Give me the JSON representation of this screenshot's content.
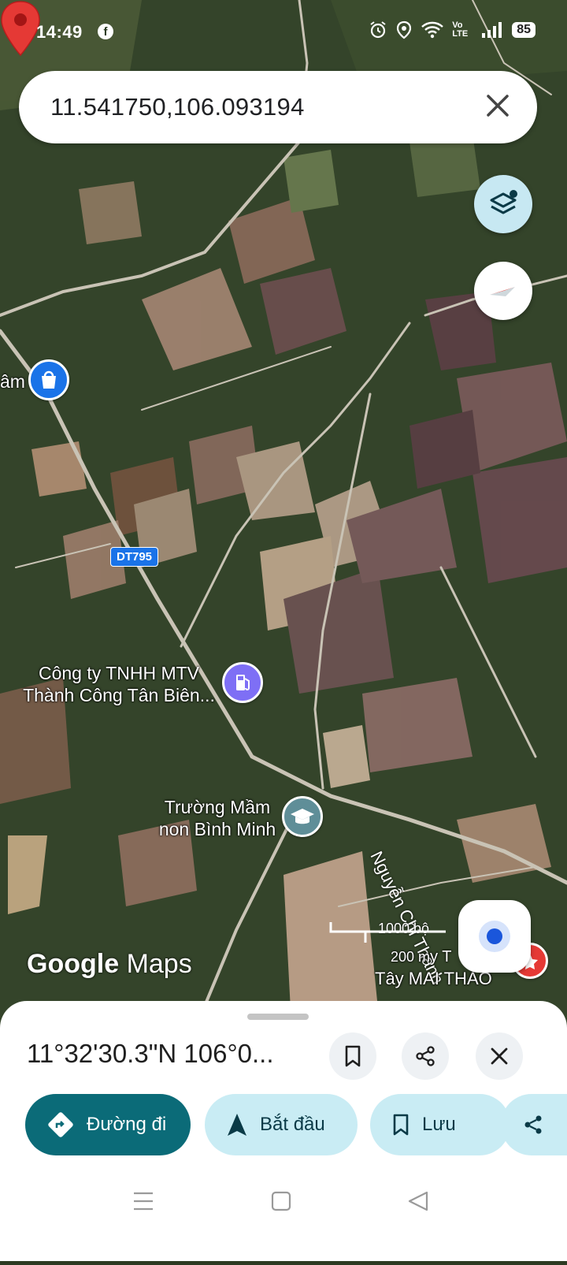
{
  "status_bar": {
    "time": "14:49",
    "network": "Vo LTE",
    "battery": "85"
  },
  "search": {
    "query": "11.541750,106.093194"
  },
  "map": {
    "labels": {
      "shop_partial": "âm",
      "road_shield": "DT795",
      "gas_station_line1": "Công ty TNHH MTV",
      "gas_station_line2": "Thành Công Tân Biên...",
      "school_line1": "Trường Mầm",
      "school_line2": "non Bình Minh",
      "road_name": "Nguyễn Chí Thanh",
      "scale_top": "1000 bộ",
      "scale_bottom": "200 m",
      "place_partial_line1": "y T",
      "place_partial_line2": "Tây MAI THẢO"
    },
    "logo_text_1": "Google",
    "logo_text_2": "Maps"
  },
  "sheet": {
    "coordinates": "11°32'30.3\"N 106°0...",
    "actions": {
      "directions": "Đường đi",
      "start": "Bắt đầu",
      "save": "Lưu"
    }
  },
  "colors": {
    "pin": "#e53935",
    "primary": "#0b6b78",
    "tonal": "#c9ecf4"
  }
}
